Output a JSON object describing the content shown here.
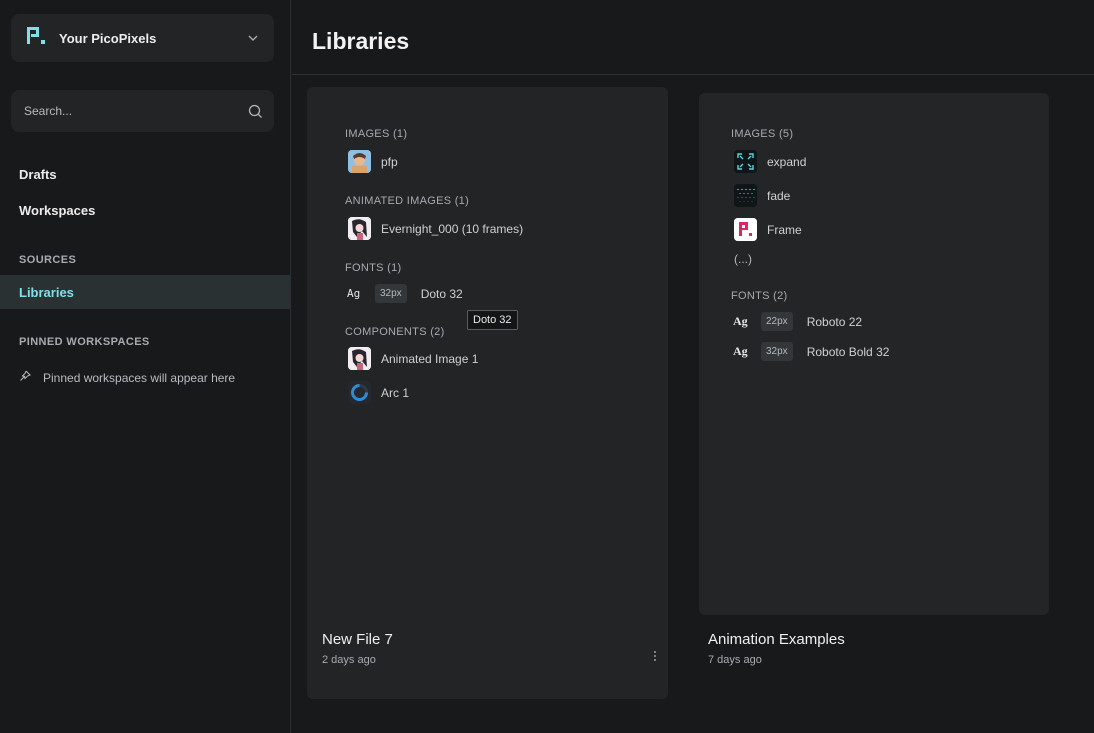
{
  "sidebar": {
    "workspace_name": "Your PicoPixels",
    "search_placeholder": "Search...",
    "nav": {
      "drafts": "Drafts",
      "workspaces": "Workspaces"
    },
    "sources_label": "SOURCES",
    "libraries": "Libraries",
    "pinned_label": "PINNED WORKSPACES",
    "pinned_empty": "Pinned workspaces will appear here"
  },
  "main": {
    "title": "Libraries",
    "tooltip": "Doto 32",
    "cards": [
      {
        "title": "New File 7",
        "subtitle": "2 days ago",
        "groups": {
          "images": {
            "label": "IMAGES (1)",
            "items": [
              "pfp"
            ]
          },
          "animated": {
            "label": "ANIMATED IMAGES (1)",
            "items": [
              "Evernight_000 (10 frames)"
            ]
          },
          "fonts": {
            "label": "FONTS (1)",
            "items": [
              {
                "ag": "Ag",
                "size": "32px",
                "name": "Doto 32"
              }
            ]
          },
          "components": {
            "label": "COMPONENTS (2)",
            "items": [
              "Animated Image 1",
              "Arc 1"
            ]
          }
        }
      },
      {
        "title": "Animation Examples",
        "subtitle": "7 days ago",
        "groups": {
          "images": {
            "label": "IMAGES (5)",
            "items": [
              "expand",
              "fade",
              "Frame"
            ],
            "more": "(...)"
          },
          "fonts": {
            "label": "FONTS (2)",
            "items": [
              {
                "ag": "Ag",
                "size": "22px",
                "name": "Roboto 22"
              },
              {
                "ag": "Ag",
                "size": "32px",
                "name": "Roboto Bold 32"
              }
            ]
          }
        }
      }
    ]
  },
  "colors": {
    "accent": "#7fe0ea",
    "background": "#18191b",
    "card": "#222426"
  },
  "icons": [
    "picopixels-logo-icon",
    "chevron-down-icon",
    "search-icon",
    "pin-icon",
    "more-vertical-icon"
  ]
}
